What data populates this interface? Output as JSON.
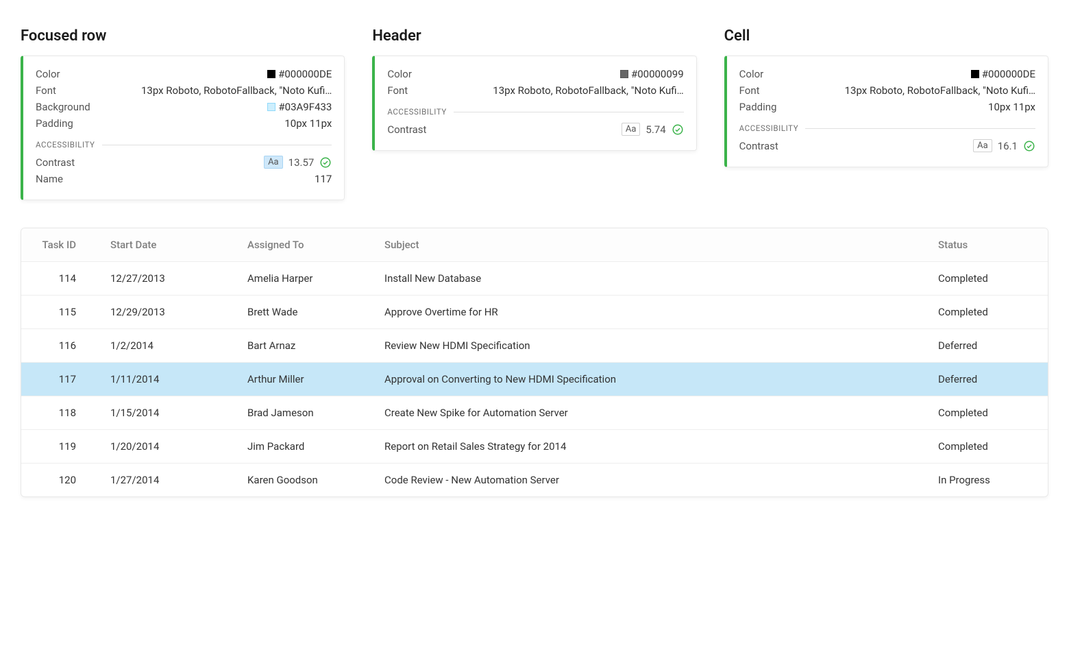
{
  "cards": [
    {
      "title": "Focused row",
      "props": [
        {
          "label": "Color",
          "value": "#000000DE",
          "swatch": "black"
        },
        {
          "label": "Font",
          "value": "13px Roboto, RobotoFallback, \"Noto Kufi…"
        },
        {
          "label": "Background",
          "value": "#03A9F433",
          "swatch": "teal"
        },
        {
          "label": "Padding",
          "value": "10px 11px"
        }
      ],
      "accessibility_label": "Accessibility",
      "contrast_label": "Contrast",
      "contrast_value": "13.57",
      "contrast_aa": "Aa",
      "contrast_highlight": true,
      "extra_label": "Name",
      "extra_value": "117"
    },
    {
      "title": "Header",
      "props": [
        {
          "label": "Color",
          "value": "#00000099",
          "swatch": "grey"
        },
        {
          "label": "Font",
          "value": "13px Roboto, RobotoFallback, \"Noto Kufi…"
        }
      ],
      "accessibility_label": "Accessibility",
      "contrast_label": "Contrast",
      "contrast_value": "5.74",
      "contrast_aa": "Aa",
      "contrast_highlight": false
    },
    {
      "title": "Cell",
      "props": [
        {
          "label": "Color",
          "value": "#000000DE",
          "swatch": "black"
        },
        {
          "label": "Font",
          "value": "13px Roboto, RobotoFallback, \"Noto Kufi…"
        },
        {
          "label": "Padding",
          "value": "10px 11px"
        }
      ],
      "accessibility_label": "Accessibility",
      "contrast_label": "Contrast",
      "contrast_value": "16.1",
      "contrast_aa": "Aa",
      "contrast_highlight": false
    }
  ],
  "grid": {
    "columns": [
      "Task ID",
      "Start Date",
      "Assigned To",
      "Subject",
      "Status"
    ],
    "focused_row_index": 3,
    "rows": [
      {
        "id": "114",
        "date": "12/27/2013",
        "assigned": "Amelia Harper",
        "subject": "Install New Database",
        "status": "Completed"
      },
      {
        "id": "115",
        "date": "12/29/2013",
        "assigned": "Brett Wade",
        "subject": "Approve Overtime for HR",
        "status": "Completed"
      },
      {
        "id": "116",
        "date": "1/2/2014",
        "assigned": "Bart Arnaz",
        "subject": "Review New HDMI Specification",
        "status": "Deferred"
      },
      {
        "id": "117",
        "date": "1/11/2014",
        "assigned": "Arthur Miller",
        "subject": "Approval on Converting to New HDMI Specification",
        "status": "Deferred"
      },
      {
        "id": "118",
        "date": "1/15/2014",
        "assigned": "Brad Jameson",
        "subject": "Create New Spike for Automation Server",
        "status": "Completed"
      },
      {
        "id": "119",
        "date": "1/20/2014",
        "assigned": "Jim Packard",
        "subject": "Report on Retail Sales Strategy for 2014",
        "status": "Completed"
      },
      {
        "id": "120",
        "date": "1/27/2014",
        "assigned": "Karen Goodson",
        "subject": "Code Review - New Automation Server",
        "status": "In Progress"
      }
    ]
  }
}
